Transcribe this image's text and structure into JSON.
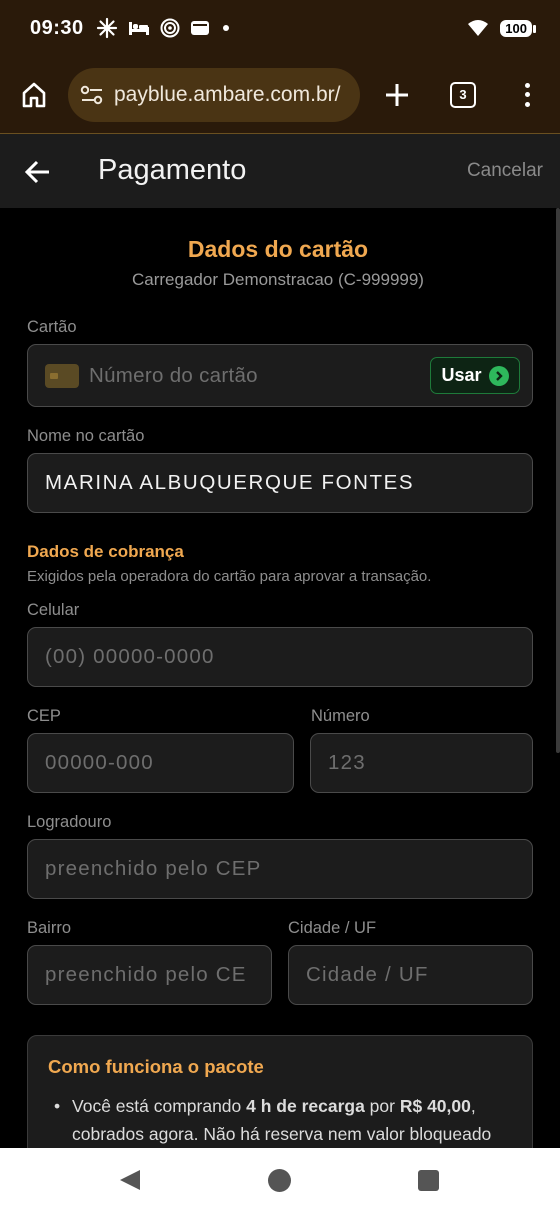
{
  "status": {
    "time": "09:30",
    "battery": "100",
    "icons": [
      "pinwheel-icon",
      "bed-icon",
      "target-icon",
      "wallet-icon",
      "dot-icon",
      "wifi-icon",
      "battery-icon"
    ]
  },
  "browser": {
    "url": "payblue.ambare.com.br/",
    "tab_count": "3",
    "icons": [
      "home-icon",
      "site-settings-icon",
      "plus-icon",
      "tabs-icon",
      "more-vert-icon"
    ]
  },
  "header": {
    "title": "Pagamento",
    "cancel_label": "Cancelar"
  },
  "card_section": {
    "title": "Dados do cartão",
    "subtitle": "Carregador Demonstracao (C-999999)",
    "card_label": "Cartão",
    "card_placeholder": "Número do cartão",
    "use_button": "Usar",
    "name_label": "Nome no cartão",
    "name_value": "MARINA ALBUQUERQUE FONTES"
  },
  "billing": {
    "title": "Dados de cobrança",
    "subtitle": "Exigidos pela operadora do cartão para aprovar a transação.",
    "phone_label": "Celular",
    "phone_placeholder": "(00) 00000-0000",
    "cep_label": "CEP",
    "cep_placeholder": "00000-000",
    "number_label": "Número",
    "number_placeholder": "123",
    "street_label": "Logradouro",
    "street_placeholder": "preenchido pelo CEP",
    "district_label": "Bairro",
    "district_placeholder": "preenchido pelo CE",
    "city_label": "Cidade / UF",
    "city_placeholder": "Cidade / UF"
  },
  "info": {
    "title": "Como funciona o pacote",
    "bullet_prefix": "Você está comprando ",
    "bullet_hours": "4 h de recarga",
    "bullet_mid": " por ",
    "bullet_price": "R$ 40,00",
    "bullet_suffix": ", cobrados agora. Não há reserva nem valor bloqueado"
  },
  "colors": {
    "accent": "#f0a850",
    "status_bg": "#2a1a0a",
    "header_bg": "#1c1c1c",
    "use_button_green": "#2eb85c"
  }
}
